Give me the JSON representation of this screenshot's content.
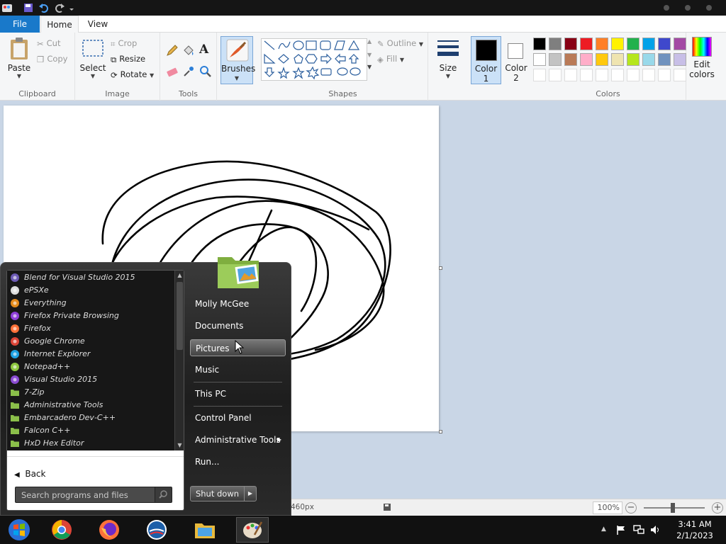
{
  "ribbon": {
    "tabs": {
      "file": "File",
      "home": "Home",
      "view": "View"
    },
    "clipboard": {
      "paste": "Paste",
      "cut": "Cut",
      "copy": "Copy",
      "label": "Clipboard"
    },
    "image": {
      "select": "Select",
      "crop": "Crop",
      "resize": "Resize",
      "rotate": "Rotate",
      "label": "Image"
    },
    "tools": {
      "label": "Tools"
    },
    "brushes": {
      "label": "Brushes"
    },
    "shapes": {
      "outline": "Outline",
      "fill": "Fill",
      "label": "Shapes"
    },
    "size": {
      "label": "Size"
    },
    "color1": {
      "line1": "Color",
      "line2": "1",
      "value": "#000000"
    },
    "color2": {
      "line1": "Color",
      "line2": "2",
      "value": "#ffffff"
    },
    "colors": {
      "label": "Colors",
      "row1": [
        "#000000",
        "#7f7f7f",
        "#880015",
        "#ed1c24",
        "#ff7f27",
        "#fff200",
        "#22b14c",
        "#00a2e8",
        "#3f48cc",
        "#a349a4"
      ],
      "row2": [
        "#ffffff",
        "#c3c3c3",
        "#b97a57",
        "#ffaec9",
        "#ffc90e",
        "#efe4b0",
        "#b5e61d",
        "#99d9ea",
        "#7092be",
        "#c8bfe7"
      ]
    },
    "edit_colors": {
      "line1": "Edit",
      "line2": "colors"
    }
  },
  "status": {
    "size": "460px",
    "zoom": "100%"
  },
  "start_menu": {
    "programs": [
      {
        "label": "Blend for Visual Studio 2015",
        "icon": "blend-icon",
        "color": "#6d5bb5"
      },
      {
        "label": "ePSXe",
        "icon": "gamepad-icon",
        "color": "#dddddd"
      },
      {
        "label": "Everything",
        "icon": "magnifier-icon",
        "color": "#e38a1a"
      },
      {
        "label": "Firefox Private Browsing",
        "icon": "firefox-private-icon",
        "color": "#8f3fd9"
      },
      {
        "label": "Firefox",
        "icon": "firefox-icon",
        "color": "#ff7139"
      },
      {
        "label": "Google Chrome",
        "icon": "chrome-icon",
        "color": "#db4437"
      },
      {
        "label": "Internet Explorer",
        "icon": "ie-icon",
        "color": "#1ea1e2"
      },
      {
        "label": "Notepad++",
        "icon": "notepad-icon",
        "color": "#8dc63f"
      },
      {
        "label": "Visual Studio 2015",
        "icon": "visual-studio-icon",
        "color": "#8a4bd1"
      },
      {
        "label": "7-Zip",
        "icon": "folder-icon",
        "color": "#8bbf4a"
      },
      {
        "label": "Administrative Tools",
        "icon": "folder-icon",
        "color": "#8bbf4a"
      },
      {
        "label": "Embarcadero Dev-C++",
        "icon": "folder-icon",
        "color": "#8bbf4a"
      },
      {
        "label": "Falcon C++",
        "icon": "folder-icon",
        "color": "#8bbf4a"
      },
      {
        "label": "HxD Hex Editor",
        "icon": "folder-icon",
        "color": "#8bbf4a"
      }
    ],
    "back": "Back",
    "search_placeholder": "Search programs and files",
    "right": {
      "user": "Molly McGee",
      "documents": "Documents",
      "pictures": "Pictures",
      "music": "Music",
      "this_pc": "This PC",
      "control_panel": "Control Panel",
      "admin_tools": "Administrative Tools",
      "run": "Run...",
      "shutdown": "Shut down"
    }
  },
  "taskbar": {
    "time": "3:41 AM",
    "date": "2/1/2023"
  }
}
